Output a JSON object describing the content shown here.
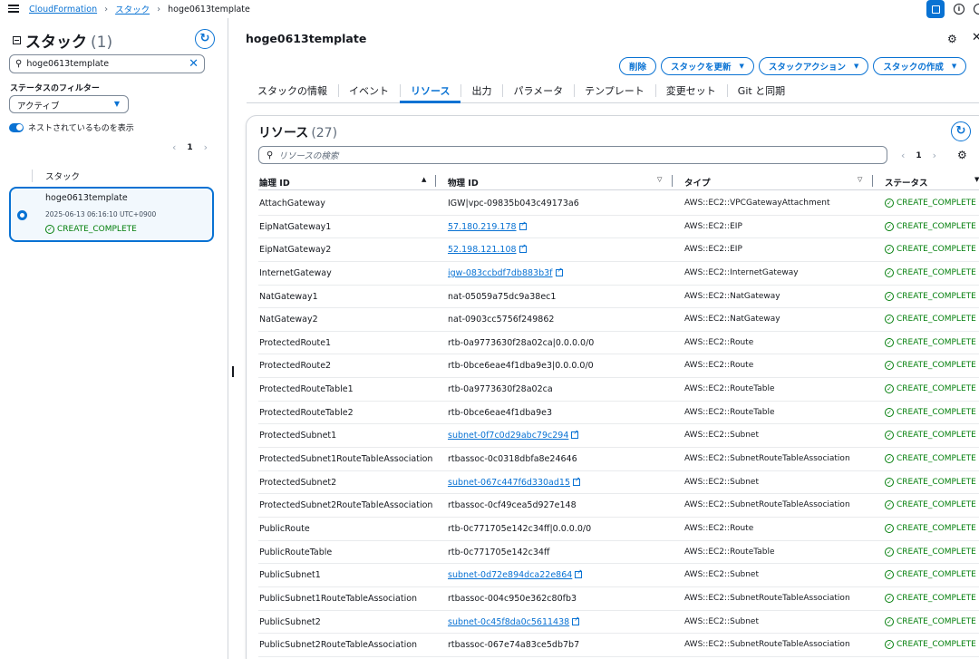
{
  "breadcrumb": {
    "service": "CloudFormation",
    "section": "スタック",
    "current": "hoge0613template"
  },
  "left_panel": {
    "title": "スタック",
    "count": "(1)",
    "search_value": "hoge0613template",
    "filter_label": "ステータスのフィルター",
    "filter_value": "アクティブ",
    "nested_toggle_label": "ネストされているものを表示",
    "page": "1",
    "column_header": "スタック",
    "stack": {
      "name": "hoge0613template",
      "date": "2025-06-13 06:16:10 UTC+0900",
      "status": "CREATE_COMPLETE"
    }
  },
  "main": {
    "title": "hoge0613template",
    "buttons": {
      "delete": "削除",
      "update": "スタックを更新",
      "actions": "スタックアクション",
      "create": "スタックの作成"
    },
    "tabs": [
      "スタックの情報",
      "イベント",
      "リソース",
      "出力",
      "パラメータ",
      "テンプレート",
      "変更セット",
      "Git と同期"
    ],
    "active_tab": "リソース"
  },
  "resources": {
    "title": "リソース",
    "count": "(27)",
    "search_placeholder": "リソースの検索",
    "page": "1",
    "columns": [
      "論理 ID",
      "物理 ID",
      "タイプ",
      "ステータス"
    ],
    "rows": [
      {
        "logical_id": "AttachGateway",
        "physical_id": "IGW|vpc-09835b043c49173a6",
        "link": false,
        "type": "AWS::EC2::VPCGatewayAttachment",
        "status": "CREATE_COMPLETE"
      },
      {
        "logical_id": "EipNatGateway1",
        "physical_id": "57.180.219.178",
        "link": true,
        "type": "AWS::EC2::EIP",
        "status": "CREATE_COMPLETE"
      },
      {
        "logical_id": "EipNatGateway2",
        "physical_id": "52.198.121.108",
        "link": true,
        "type": "AWS::EC2::EIP",
        "status": "CREATE_COMPLETE"
      },
      {
        "logical_id": "InternetGateway",
        "physical_id": "igw-083ccbdf7db883b3f",
        "link": true,
        "type": "AWS::EC2::InternetGateway",
        "status": "CREATE_COMPLETE"
      },
      {
        "logical_id": "NatGateway1",
        "physical_id": "nat-05059a75dc9a38ec1",
        "link": false,
        "type": "AWS::EC2::NatGateway",
        "status": "CREATE_COMPLETE"
      },
      {
        "logical_id": "NatGateway2",
        "physical_id": "nat-0903cc5756f249862",
        "link": false,
        "type": "AWS::EC2::NatGateway",
        "status": "CREATE_COMPLETE"
      },
      {
        "logical_id": "ProtectedRoute1",
        "physical_id": "rtb-0a9773630f28a02ca|0.0.0.0/0",
        "link": false,
        "type": "AWS::EC2::Route",
        "status": "CREATE_COMPLETE"
      },
      {
        "logical_id": "ProtectedRoute2",
        "physical_id": "rtb-0bce6eae4f1dba9e3|0.0.0.0/0",
        "link": false,
        "type": "AWS::EC2::Route",
        "status": "CREATE_COMPLETE"
      },
      {
        "logical_id": "ProtectedRouteTable1",
        "physical_id": "rtb-0a9773630f28a02ca",
        "link": false,
        "type": "AWS::EC2::RouteTable",
        "status": "CREATE_COMPLETE"
      },
      {
        "logical_id": "ProtectedRouteTable2",
        "physical_id": "rtb-0bce6eae4f1dba9e3",
        "link": false,
        "type": "AWS::EC2::RouteTable",
        "status": "CREATE_COMPLETE"
      },
      {
        "logical_id": "ProtectedSubnet1",
        "physical_id": "subnet-0f7c0d29abc79c294",
        "link": true,
        "type": "AWS::EC2::Subnet",
        "status": "CREATE_COMPLETE"
      },
      {
        "logical_id": "ProtectedSubnet1RouteTableAssociation",
        "physical_id": "rtbassoc-0c0318dbfa8e24646",
        "link": false,
        "type": "AWS::EC2::SubnetRouteTableAssociation",
        "status": "CREATE_COMPLETE"
      },
      {
        "logical_id": "ProtectedSubnet2",
        "physical_id": "subnet-067c447f6d330ad15",
        "link": true,
        "type": "AWS::EC2::Subnet",
        "status": "CREATE_COMPLETE"
      },
      {
        "logical_id": "ProtectedSubnet2RouteTableAssociation",
        "physical_id": "rtbassoc-0cf49cea5d927e148",
        "link": false,
        "type": "AWS::EC2::SubnetRouteTableAssociation",
        "status": "CREATE_COMPLETE"
      },
      {
        "logical_id": "PublicRoute",
        "physical_id": "rtb-0c771705e142c34ff|0.0.0.0/0",
        "link": false,
        "type": "AWS::EC2::Route",
        "status": "CREATE_COMPLETE"
      },
      {
        "logical_id": "PublicRouteTable",
        "physical_id": "rtb-0c771705e142c34ff",
        "link": false,
        "type": "AWS::EC2::RouteTable",
        "status": "CREATE_COMPLETE"
      },
      {
        "logical_id": "PublicSubnet1",
        "physical_id": "subnet-0d72e894dca22e864",
        "link": true,
        "type": "AWS::EC2::Subnet",
        "status": "CREATE_COMPLETE"
      },
      {
        "logical_id": "PublicSubnet1RouteTableAssociation",
        "physical_id": "rtbassoc-004c950e362c80fb3",
        "link": false,
        "type": "AWS::EC2::SubnetRouteTableAssociation",
        "status": "CREATE_COMPLETE"
      },
      {
        "logical_id": "PublicSubnet2",
        "physical_id": "subnet-0c45f8da0c5611438",
        "link": true,
        "type": "AWS::EC2::Subnet",
        "status": "CREATE_COMPLETE"
      },
      {
        "logical_id": "PublicSubnet2RouteTableAssociation",
        "physical_id": "rtbassoc-067e74a83ce5db7b7",
        "link": false,
        "type": "AWS::EC2::SubnetRouteTableAssociation",
        "status": "CREATE_COMPLETE"
      }
    ]
  },
  "colors": {
    "accent": "#0972d3",
    "success": "#037f0c",
    "text": "#16191f"
  }
}
